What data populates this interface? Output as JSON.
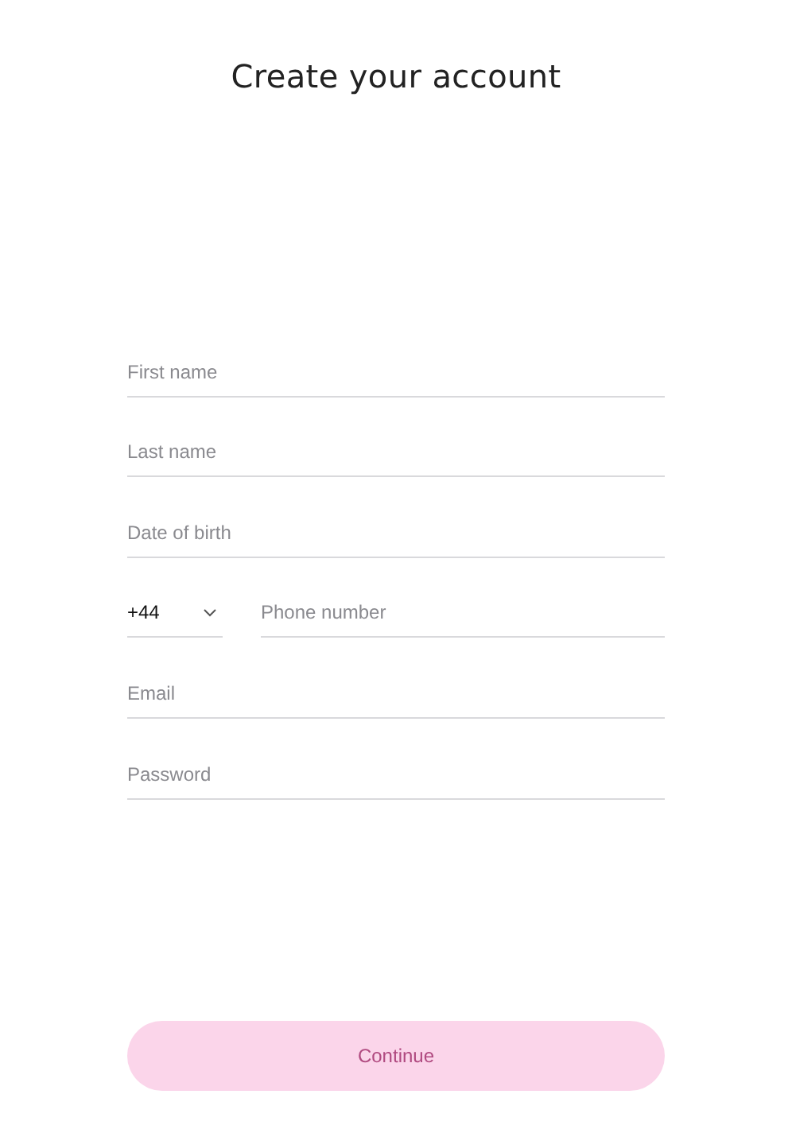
{
  "title": "Create your account",
  "fields": [
    {
      "kind": "text",
      "placeholder": "First name"
    },
    {
      "kind": "text",
      "placeholder": "Last name"
    },
    {
      "kind": "text",
      "placeholder": "Date of birth"
    },
    {
      "kind": "phone",
      "code": "+44",
      "placeholder": "Phone number"
    },
    {
      "kind": "text",
      "placeholder": "Email"
    },
    {
      "kind": "password",
      "placeholder": "Password"
    }
  ],
  "button": {
    "label": "Continue",
    "disabled": true
  }
}
